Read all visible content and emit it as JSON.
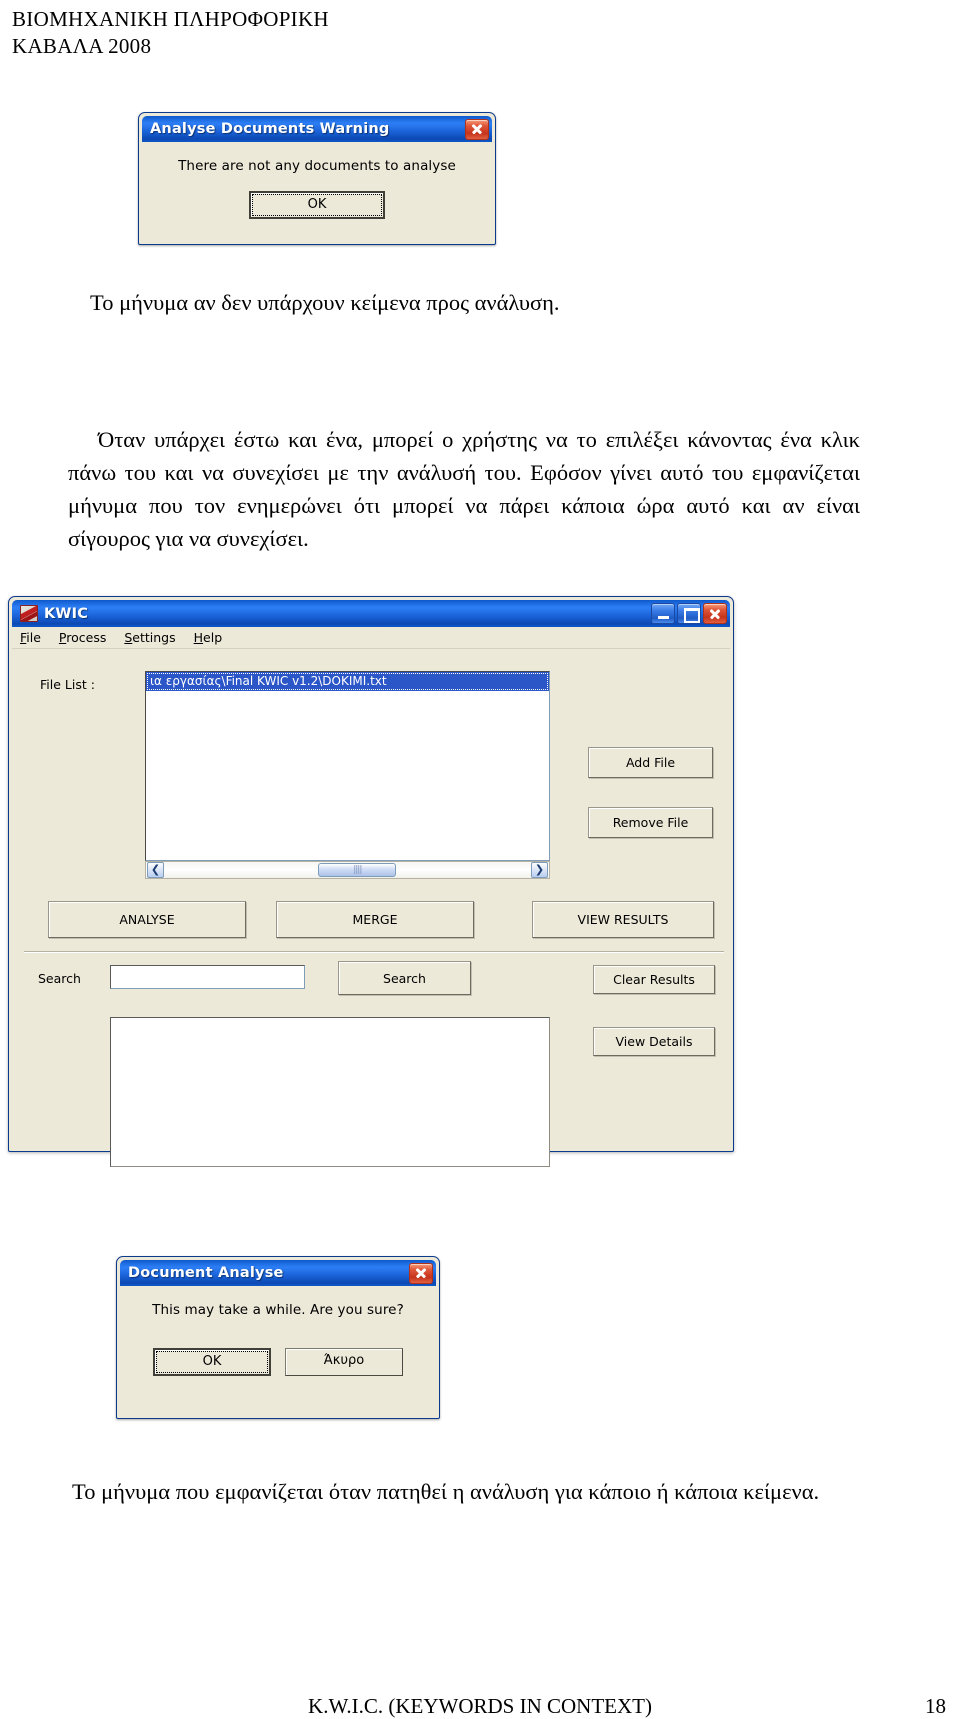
{
  "document": {
    "header_line1": "ΒΙΟΜΗΧΑΝΙΚΗ ΠΛΗΡΟΦΟΡΙΚΗ",
    "header_line2": "ΚΑΒΑΛΑ 2008",
    "caption1": "Το μήνυμα αν δεν υπάρχουν κείμενα προς ανάλυση.",
    "paragraph1": "Όταν υπάρχει έστω και ένα, μπορεί ο χρήστης να το επιλέξει κάνοντας ένα κλικ πάνω του και να συνεχίσει με την ανάλυσή του. Εφόσον γίνει αυτό του εμφανίζεται μήνυμα που τον ενημερώνει ότι μπορεί να πάρει κάποια ώρα αυτό και αν είναι σίγουρος για να συνεχίσει.",
    "caption2": "Το μήνυμα που εμφανίζεται όταν πατηθεί η ανάλυση για κάποιο ή κάποια κείμενα.",
    "footer_title": "K.W.I.C.   (KEYWORDS IN CONTEXT)",
    "footer_page": "18"
  },
  "warning_dialog": {
    "title": "Analyse Documents Warning",
    "message": "There are not any documents to analyse",
    "ok_label": "OK",
    "close_icon": "close-icon"
  },
  "kwic_window": {
    "title": "KWIC",
    "app_icon": "kwic-app-icon",
    "minimize_icon": "minimize-icon",
    "maximize_icon": "maximize-icon",
    "close_icon": "close-icon",
    "menus": [
      {
        "label": "File",
        "mnemonic": "F"
      },
      {
        "label": "Process",
        "mnemonic": "P"
      },
      {
        "label": "Settings",
        "mnemonic": "S"
      },
      {
        "label": "Help",
        "mnemonic": "H"
      }
    ],
    "file_list_label": "File List :",
    "file_list_items": [
      "ια εργασίας\\Final KWIC v1.2\\DOKIMI.txt"
    ],
    "scroll_left_icon": "chevron-left-icon",
    "scroll_right_icon": "chevron-right-icon",
    "add_file_label": "Add File",
    "remove_file_label": "Remove File",
    "analyse_label": "ANALYSE",
    "merge_label": "MERGE",
    "view_results_label": "VIEW RESULTS",
    "search_label": "Search",
    "search_value": "",
    "search_placeholder": "",
    "search_button_label": "Search",
    "clear_results_label": "Clear Results",
    "view_details_label": "View Details",
    "results_value": ""
  },
  "analyse_dialog": {
    "title": "Document Analyse",
    "message": "This may take a while. Are you sure?",
    "ok_label": "OK",
    "cancel_label": "Άκυρο",
    "close_icon": "close-icon"
  }
}
